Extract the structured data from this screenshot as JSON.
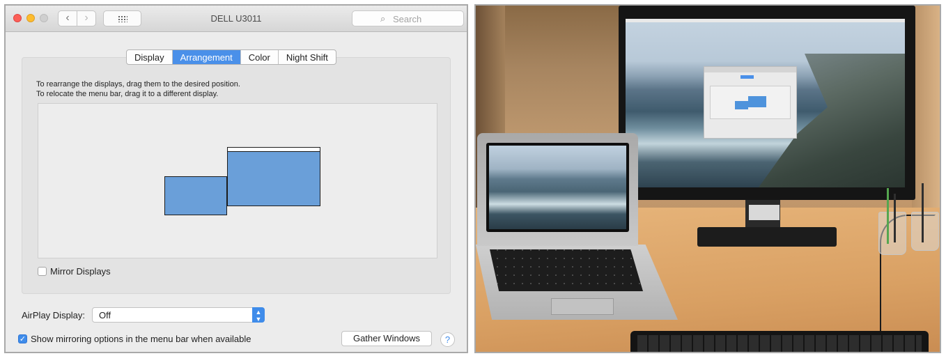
{
  "window": {
    "title": "DELL U3011",
    "search_placeholder": "Search"
  },
  "tabs": [
    {
      "label": "Display",
      "active": false
    },
    {
      "label": "Arrangement",
      "active": true
    },
    {
      "label": "Color",
      "active": false
    },
    {
      "label": "Night Shift",
      "active": false
    }
  ],
  "arrangement": {
    "instruction_1": "To rearrange the displays, drag them to the desired position.",
    "instruction_2": "To relocate the menu bar, drag it to a different display."
  },
  "mirror": {
    "label": "Mirror Displays",
    "checked": false
  },
  "airplay": {
    "label": "AirPlay Display:",
    "selected": "Off"
  },
  "show_mirroring": {
    "label": "Show mirroring options in the menu bar when available",
    "checked": true
  },
  "buttons": {
    "gather": "Gather Windows",
    "help": "?"
  },
  "icons": {
    "back": "‹",
    "forward": "›",
    "search": "⌕",
    "checkmark": "✓",
    "select_arrows": "▲▼"
  },
  "colors": {
    "accent": "#4a90e9",
    "display_fill": "#6a9fd9"
  }
}
